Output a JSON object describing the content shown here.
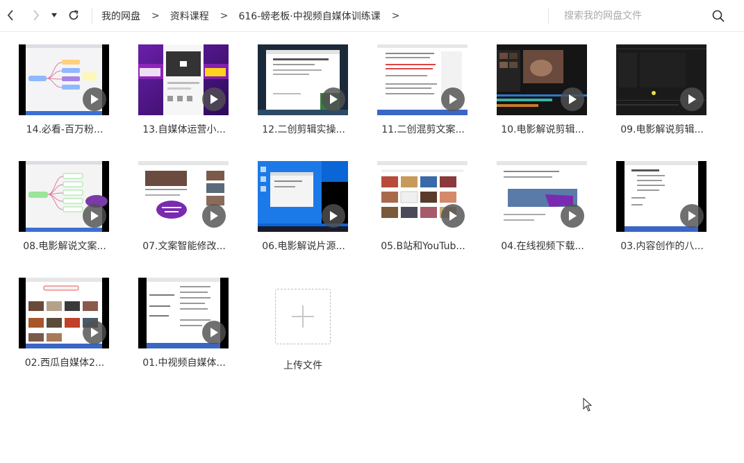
{
  "toolbar": {
    "back_icon": "chevron-left-icon",
    "forward_icon": "chevron-right-icon",
    "history_icon": "caret-down-icon",
    "refresh_icon": "refresh-icon"
  },
  "breadcrumb": {
    "items": [
      "我的网盘",
      "资料课程",
      "616-螃老板·中视频自媒体训练课"
    ],
    "separator": ">"
  },
  "search": {
    "placeholder": "搜索我的网盘文件",
    "icon": "search-icon"
  },
  "files": [
    {
      "name": "14.必看-百万粉...",
      "thumb_style": "mindmap",
      "play_icon": "play-icon"
    },
    {
      "name": "13.自媒体运营小...",
      "thumb_style": "phone-purple",
      "play_icon": "play-icon"
    },
    {
      "name": "12.二创剪辑实操...",
      "thumb_style": "browser-dark",
      "play_icon": "play-icon"
    },
    {
      "name": "11.二创混剪文案...",
      "thumb_style": "document",
      "play_icon": "play-icon"
    },
    {
      "name": "10.电影解说剪辑...",
      "thumb_style": "editor-video",
      "play_icon": "play-icon"
    },
    {
      "name": "09.电影解说剪辑...",
      "thumb_style": "editor-dark",
      "play_icon": "play-icon"
    },
    {
      "name": "08.电影解说文案...",
      "thumb_style": "mindmap-2",
      "play_icon": "play-icon"
    },
    {
      "name": "07.文案智能修改...",
      "thumb_style": "browser-bubble",
      "play_icon": "play-icon"
    },
    {
      "name": "06.电影解说片源...",
      "thumb_style": "desktop-blue",
      "play_icon": "play-icon"
    },
    {
      "name": "05.B站和YouTub...",
      "thumb_style": "video-grid",
      "play_icon": "play-icon"
    },
    {
      "name": "04.在线视频下载...",
      "thumb_style": "browser-purple",
      "play_icon": "play-icon"
    },
    {
      "name": "03.内容创作的八...",
      "thumb_style": "outline",
      "play_icon": "play-icon"
    },
    {
      "name": "02.西瓜自媒体2...",
      "thumb_style": "video-grid-2",
      "play_icon": "play-icon"
    },
    {
      "name": "01.中视频自媒体...",
      "thumb_style": "outline-2",
      "play_icon": "play-icon"
    }
  ],
  "upload": {
    "label": "上传文件",
    "icon": "plus-icon"
  },
  "colors": {
    "text": "#333333",
    "placeholder": "#aaaaaa",
    "thumb_bg": "#000000",
    "play_bg": "#505050"
  }
}
